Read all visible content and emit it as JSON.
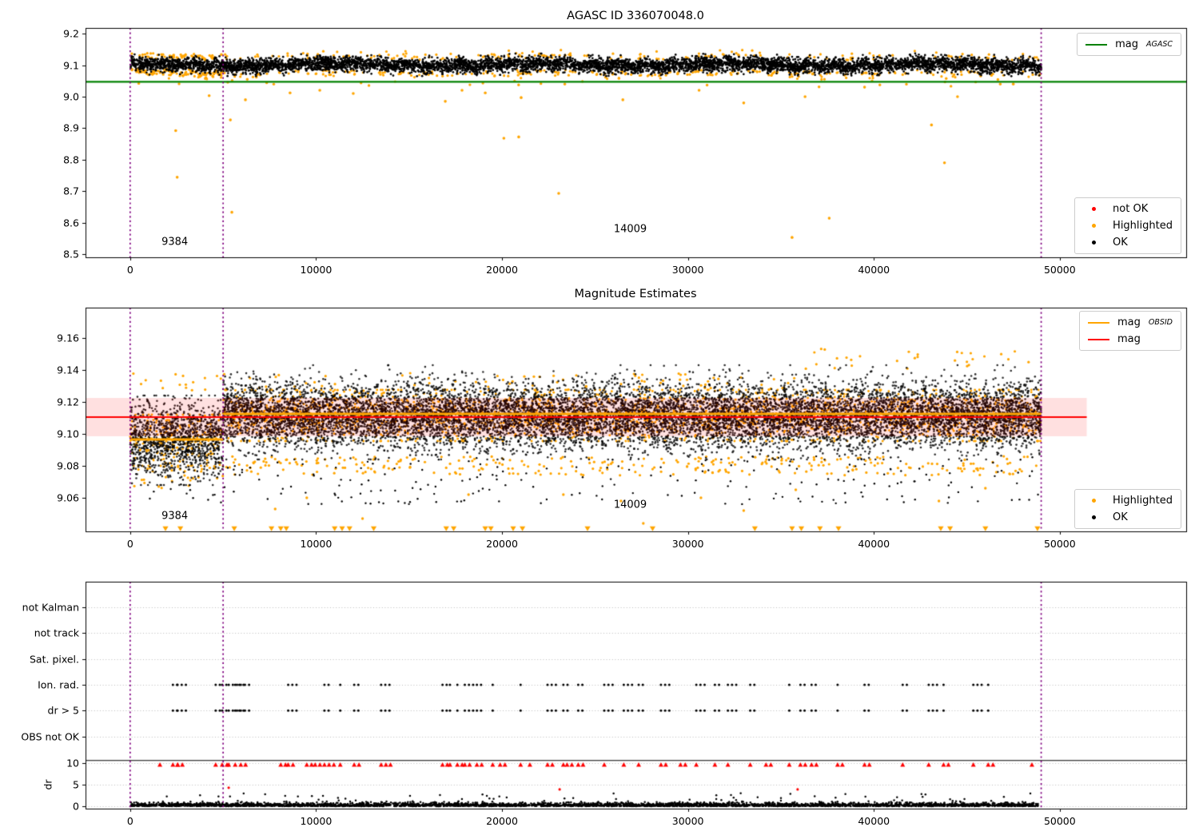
{
  "colors": {
    "ok": "#000000",
    "highlighted": "#ffa500",
    "not_ok": "#ff0000",
    "mag_agasc_line": "#008000",
    "mag_line": "#ff0000",
    "mag_obsid_line": "#ffa500",
    "obsid_vline": "#800080",
    "mag_band_fill": "rgba(255,0,0,0.12)",
    "grid": "#bbbbbb",
    "frame": "#000000"
  },
  "chart_data": [
    {
      "id": "top-mags",
      "type": "scatter",
      "title": "AGASC ID 336070048.0",
      "xlim": [
        -2400,
        56800
      ],
      "ylim": [
        8.49,
        9.218
      ],
      "xticks": [
        0,
        10000,
        20000,
        30000,
        40000,
        50000
      ],
      "xtick_labels": [
        "0",
        "10000",
        "20000",
        "30000",
        "40000",
        "50000"
      ],
      "yticks": [
        8.5,
        8.6,
        8.7,
        8.8,
        8.9,
        9.0,
        9.1,
        9.2
      ],
      "ytick_labels": [
        "8.5",
        "8.6",
        "8.7",
        "8.8",
        "8.9",
        "9.0",
        "9.1",
        "9.2"
      ],
      "grid": false,
      "vlines_x": [
        0,
        5000,
        49000
      ],
      "agasc_mag_line": {
        "y": 9.047
      },
      "legend_top": {
        "position": "upper right",
        "rows": [
          {
            "marker": "line",
            "color": "#008000",
            "text": "mag",
            "sub": "AGASC"
          }
        ]
      },
      "legend_bottom": {
        "position": "lower right",
        "rows": [
          {
            "marker": "dot",
            "color": "#ff0000",
            "text": "not OK"
          },
          {
            "marker": "dot",
            "color": "#ffa500",
            "text": "Highlighted"
          },
          {
            "marker": "dot",
            "color": "#000000",
            "text": "OK"
          }
        ]
      },
      "annotations": [
        {
          "text": "9384",
          "x": 2400,
          "y": 8.537
        },
        {
          "text": "14009",
          "x": 26900,
          "y": 8.578
        }
      ],
      "ok_cloud": {
        "n": 6500,
        "x_range": [
          0,
          49000
        ],
        "center": 9.101,
        "sigma": 0.0115,
        "clip": 0.0295
      },
      "highlighted_fringe": {
        "n": 480,
        "extra_left_n": 140,
        "offset_min": 0.0215
      },
      "near_line_strays": {
        "n": 26,
        "y_range": [
          9.03,
          9.058
        ]
      },
      "highlighted_outliers": [
        [
          2450,
          8.892
        ],
        [
          2530,
          8.744
        ],
        [
          4250,
          9.003
        ],
        [
          5390,
          8.926
        ],
        [
          5470,
          8.633
        ],
        [
          6200,
          8.99
        ],
        [
          8600,
          9.012
        ],
        [
          10200,
          9.02
        ],
        [
          12000,
          9.01
        ],
        [
          16950,
          8.985
        ],
        [
          17850,
          9.02
        ],
        [
          19100,
          9.012
        ],
        [
          20100,
          8.868
        ],
        [
          20900,
          8.872
        ],
        [
          21030,
          8.997
        ],
        [
          23050,
          8.693
        ],
        [
          26500,
          8.99
        ],
        [
          30600,
          9.02
        ],
        [
          33000,
          8.98
        ],
        [
          35600,
          8.553
        ],
        [
          36300,
          9.0
        ],
        [
          37600,
          8.614
        ],
        [
          39500,
          9.03
        ],
        [
          43100,
          8.91
        ],
        [
          43800,
          8.79
        ],
        [
          44500,
          9.0
        ],
        [
          47500,
          9.04
        ]
      ]
    },
    {
      "id": "middle-magnitude-estimates",
      "type": "scatter",
      "title": "Magnitude Estimates",
      "xlim": [
        -2400,
        56800
      ],
      "ylim": [
        9.039,
        9.179
      ],
      "xticks": [
        0,
        10000,
        20000,
        30000,
        40000,
        50000
      ],
      "xtick_labels": [
        "0",
        "10000",
        "20000",
        "30000",
        "40000",
        "50000"
      ],
      "yticks": [
        9.06,
        9.08,
        9.1,
        9.12,
        9.14,
        9.16
      ],
      "ytick_labels": [
        "9.06",
        "9.08",
        "9.10",
        "9.12",
        "9.14",
        "9.16"
      ],
      "grid": false,
      "vlines_x": [
        0,
        5000,
        49000
      ],
      "mag_line": {
        "y": 9.1105,
        "x_end": 51450
      },
      "mag_band": {
        "y0": 9.0985,
        "y1": 9.1225,
        "x_end": 51450
      },
      "obsid_segments": [
        {
          "x0": 0,
          "x1": 5000,
          "y": 9.0965
        },
        {
          "x0": 5000,
          "x1": 49000,
          "y": 9.1125
        }
      ],
      "legend_top": {
        "position": "upper right",
        "rows": [
          {
            "marker": "line",
            "color": "#ffa500",
            "text": "mag",
            "sub": "OBSID"
          },
          {
            "marker": "line",
            "color": "#ff0000",
            "text": "mag"
          }
        ]
      },
      "legend_bottom": {
        "position": "lower right",
        "rows": [
          {
            "marker": "dot",
            "color": "#ffa500",
            "text": "Highlighted"
          },
          {
            "marker": "dot",
            "color": "#000000",
            "text": "OK"
          }
        ]
      },
      "annotations": [
        {
          "text": "9384",
          "x": 2400,
          "y": 9.0487
        },
        {
          "text": "14009",
          "x": 26900,
          "y": 9.0555
        }
      ],
      "segments": {
        "left": {
          "x_range": [
            0,
            5000
          ],
          "center": 9.096,
          "sigma": 0.012,
          "clip": 0.028
        },
        "right": {
          "x_range": [
            5000,
            49000
          ],
          "center": 9.1115,
          "sigma": 0.0105,
          "clip_up": 0.0315,
          "clip_down": 0.0275
        }
      },
      "ok_n": 11500,
      "core_highlighted_n": 2400,
      "sparse_tail": {
        "n": 230,
        "y_range": [
          9.056,
          9.086
        ]
      },
      "fringe_low_n": 330,
      "fringe_high_n": 120,
      "highlighted_low_strays": [
        [
          7800,
          9.053
        ],
        [
          9500,
          9.06
        ],
        [
          12500,
          9.047
        ],
        [
          18200,
          9.062
        ],
        [
          23300,
          9.062
        ],
        [
          26400,
          9.058
        ],
        [
          27600,
          9.044
        ],
        [
          30700,
          9.06
        ],
        [
          33000,
          9.052
        ],
        [
          35800,
          9.065
        ],
        [
          43500,
          9.058
        ],
        [
          46000,
          9.066
        ]
      ],
      "clipped_low_x": [
        1900,
        2700,
        5600,
        7600,
        8100,
        8400,
        11000,
        11400,
        11800,
        13100,
        17000,
        17400,
        19100,
        19400,
        20600,
        21100,
        24600,
        28100,
        33600,
        35600,
        36100,
        37100,
        38100,
        43600,
        44100,
        46000,
        48800
      ]
    },
    {
      "id": "bottom-flags",
      "type": "scatter",
      "row_labels": [
        "not Kalman",
        "not track",
        "Sat. pixel.",
        "Ion. rad.",
        "dr > 5",
        "OBS not OK"
      ],
      "flag_rows_with_points": [
        "Ion. rad.",
        "dr > 5"
      ],
      "dr_axis_label": "dr",
      "dr_ticks": [
        10,
        5,
        0
      ],
      "dr_tick_labels": [
        "10",
        "5",
        "0"
      ],
      "xticks": [
        0,
        10000,
        20000,
        30000,
        40000,
        50000
      ],
      "xtick_labels": [
        "0",
        "10000",
        "20000",
        "30000",
        "40000",
        "50000"
      ],
      "grid": true,
      "vlines_x": [
        0,
        5000,
        49000
      ],
      "separator_line_dr": 10.6,
      "flag_points_x": [
        2300,
        2550,
        4600,
        4950,
        5300,
        5650,
        5950,
        8500,
        10450,
        11300,
        12050,
        13500,
        16800,
        17200,
        17600,
        18000,
        18650,
        19500,
        21000,
        22450,
        23300,
        24100,
        25500,
        26550,
        27350,
        28550,
        30450,
        31450,
        32150,
        33350,
        35450,
        36050,
        36650,
        38050,
        39500,
        41550,
        42950,
        43750,
        45350,
        46150
      ],
      "dr_clipped_red_x": [
        1600,
        2300,
        2550,
        4600,
        4950,
        5300,
        5650,
        5950,
        8100,
        8500,
        9500,
        9950,
        10450,
        10700,
        11300,
        12050,
        13500,
        14000,
        16800,
        17200,
        17600,
        18000,
        18650,
        19500,
        19900,
        21000,
        21500,
        22450,
        23300,
        23500,
        24100,
        25500,
        26550,
        27350,
        28550,
        29600,
        30450,
        31450,
        32150,
        33350,
        34200,
        35450,
        36050,
        36650,
        38050,
        39500,
        41550,
        42950,
        43750,
        45350,
        46150,
        48500
      ],
      "dr_red_strays": [
        [
          5300,
          4.3
        ],
        [
          23100,
          3.9
        ],
        [
          35900,
          3.9
        ]
      ],
      "dr_band": {
        "n": 3600,
        "x_range": [
          0,
          48900
        ],
        "typical_max": 1.0,
        "sparse_max": 3.0
      }
    }
  ]
}
